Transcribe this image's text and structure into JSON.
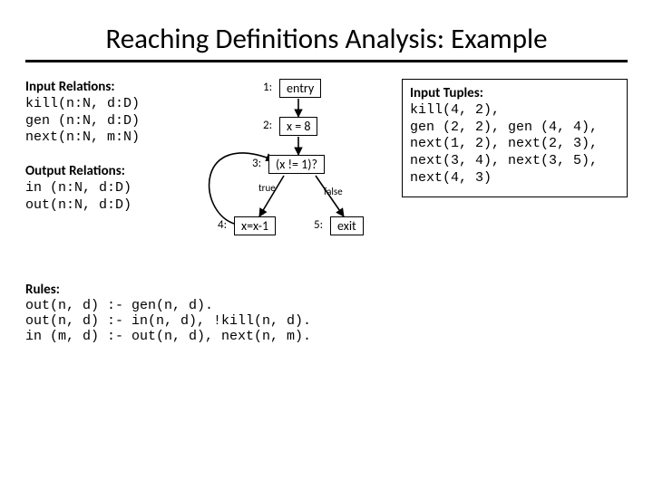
{
  "title": "Reaching Definitions Analysis: Example",
  "input_relations": {
    "header": "Input Relations:",
    "lines": "kill(n:N, d:D)\ngen (n:N, d:D)\nnext(n:N, m:N)"
  },
  "output_relations": {
    "header": "Output Relations:",
    "lines": "in (n:N, d:D)\nout(n:N, d:D)"
  },
  "cfg": {
    "n1": {
      "id": "1:",
      "label": "entry"
    },
    "n2": {
      "id": "2:",
      "label": "x = 8"
    },
    "n3": {
      "id": "3:",
      "label": "(x != 1)?"
    },
    "n4": {
      "id": "4:",
      "label": "x=x-1"
    },
    "n5": {
      "id": "5:",
      "label": "exit"
    },
    "true_label": "true",
    "false_label": "false"
  },
  "input_tuples": {
    "header": "Input Tuples:",
    "lines": "kill(4, 2),\ngen (2, 2), gen (4, 4),\nnext(1, 2), next(2, 3),\nnext(3, 4), next(3, 5),\nnext(4, 3)"
  },
  "rules": {
    "header": "Rules:",
    "lines": "out(n, d) :- gen(n, d).\nout(n, d) :- in(n, d), !kill(n, d).\nin (m, d) :- out(n, d), next(n, m)."
  }
}
